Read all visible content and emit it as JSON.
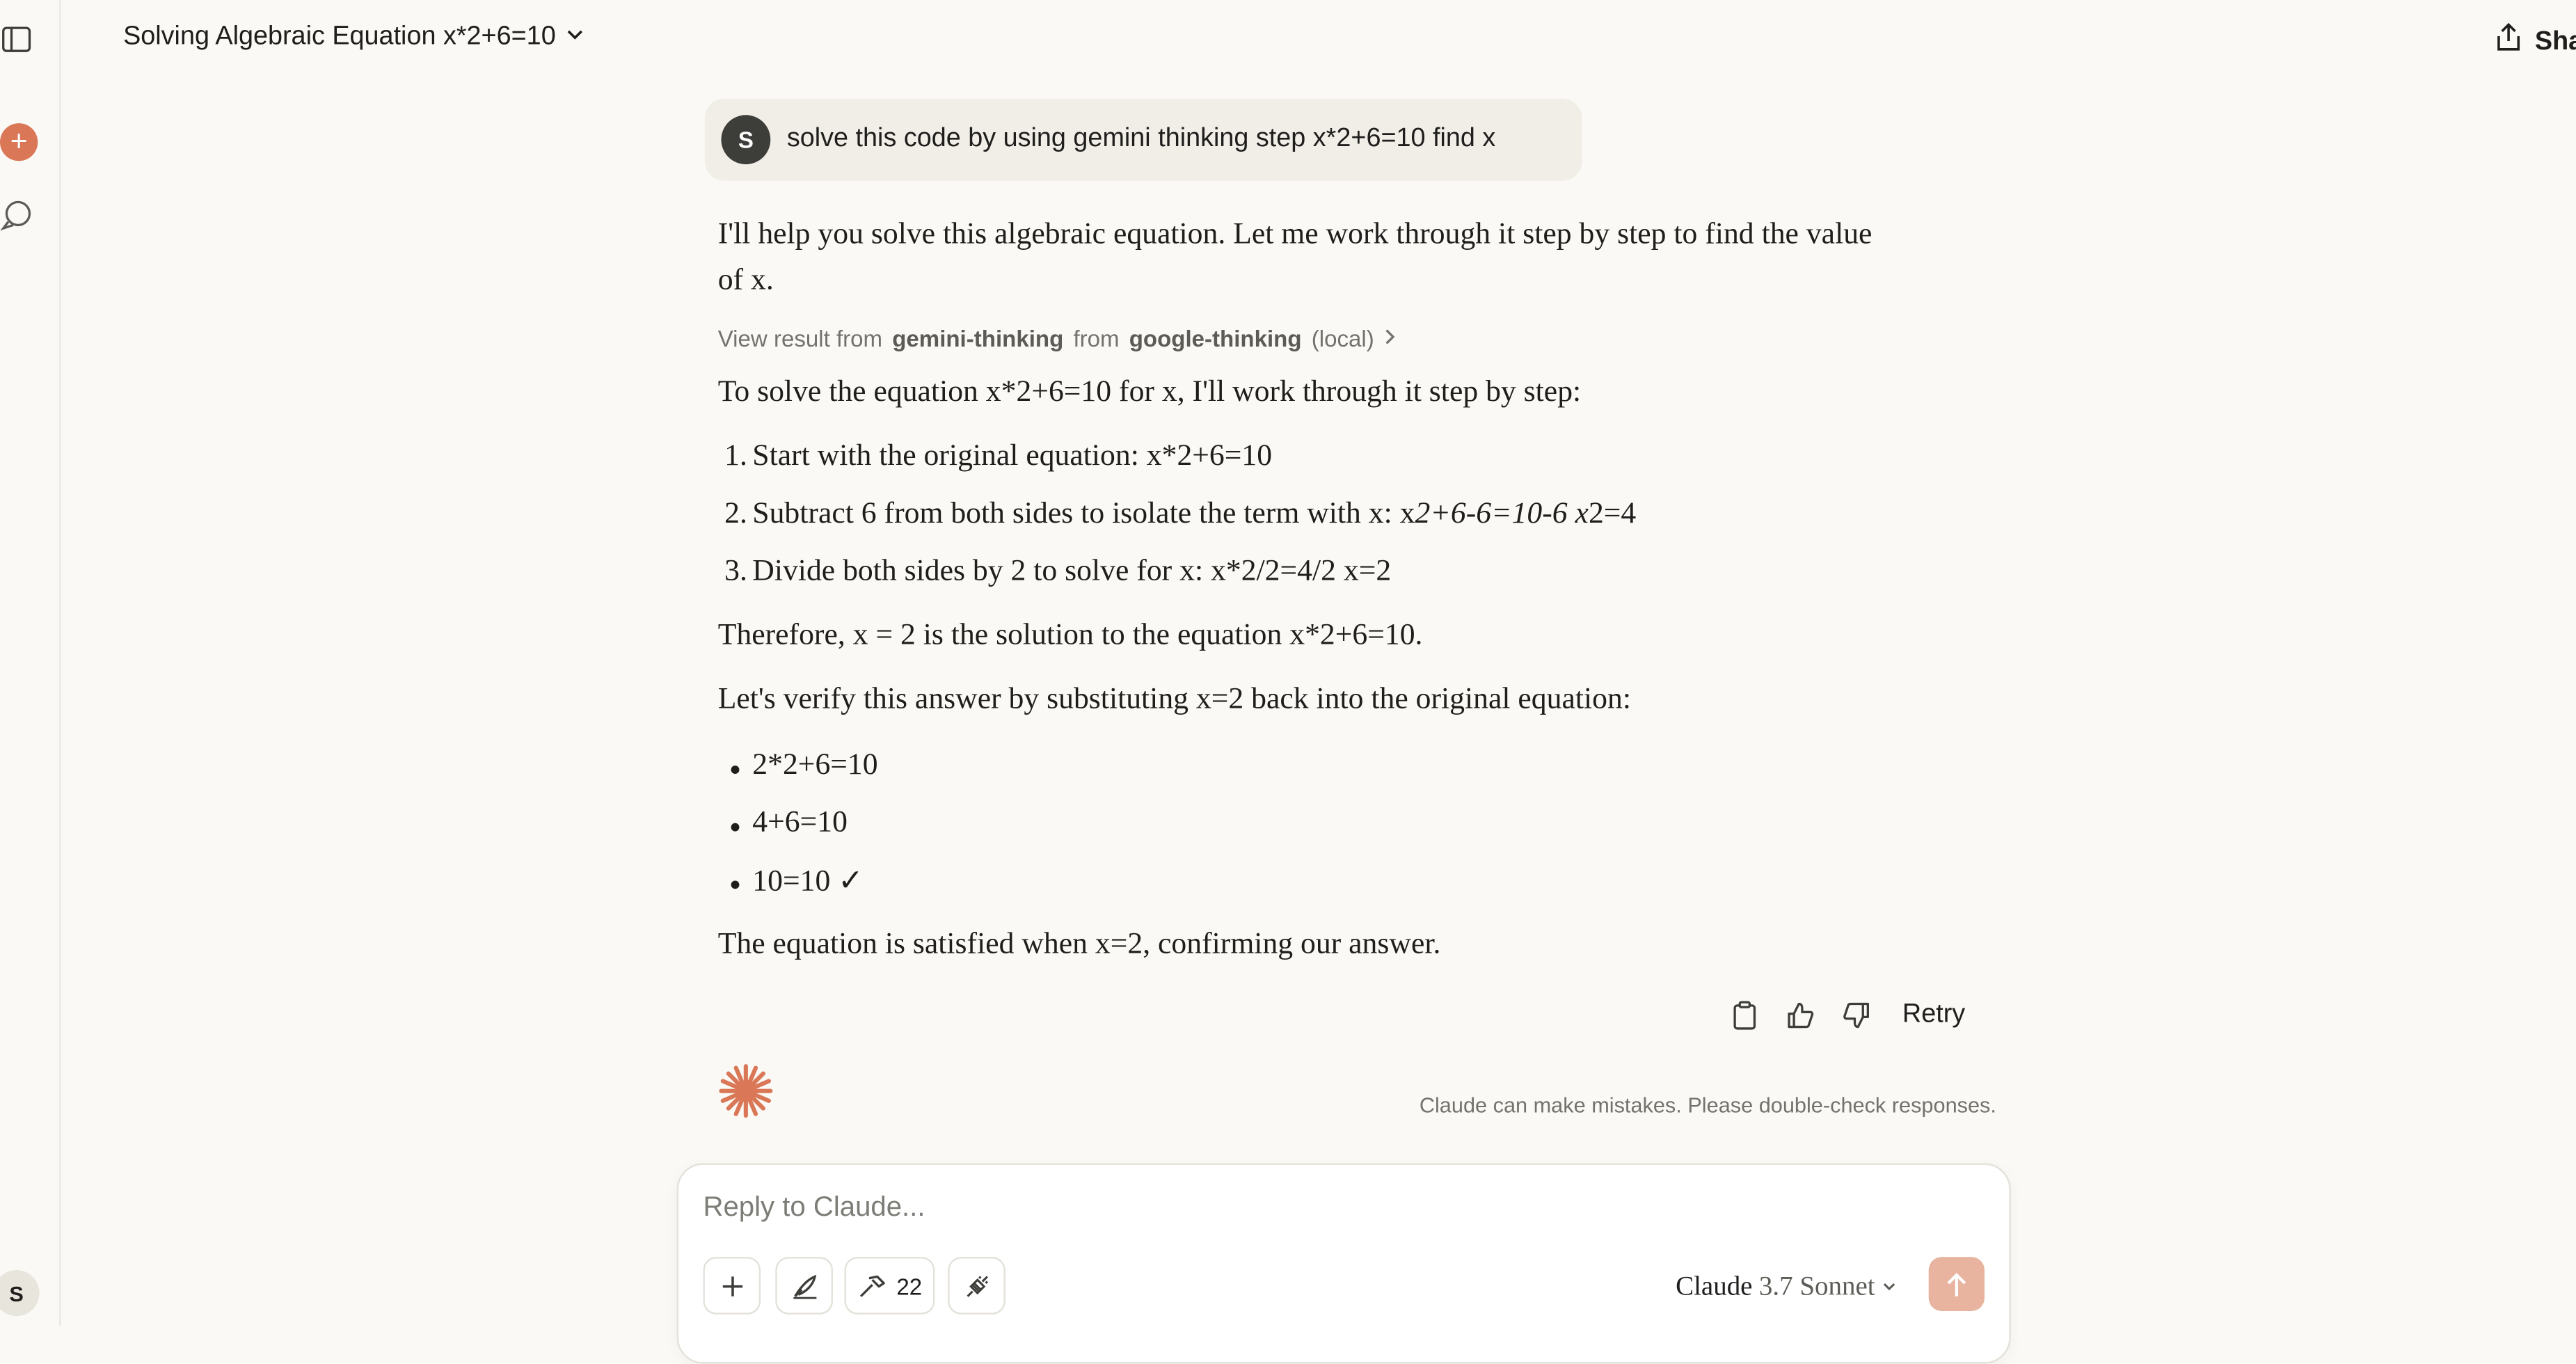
{
  "header": {
    "title": "Solving Algebraic Equation x*2+6=10",
    "share_label": "Sha"
  },
  "sidebar": {
    "user_initial": "S",
    "new_chat_symbol": "+"
  },
  "user_message": {
    "avatar_initial": "S",
    "text": "solve this code by using gemini thinking step x*2+6=10 find x"
  },
  "assistant": {
    "intro_line1": "I'll help you solve this algebraic equation. Let me work through it step by step to find the value",
    "intro_line2": "of x.",
    "tool_result": {
      "prefix": "View result from",
      "tool": "gemini-thinking",
      "mid": "from",
      "server": "google-thinking",
      "suffix": "(local)"
    },
    "solve_intro": "To solve the equation x*2+6=10 for x, I'll work through it step by step:",
    "steps": [
      {
        "num": "1.",
        "text": "Start with the original equation: x*2+6=10"
      },
      {
        "num": "2.",
        "text_a": "Subtract 6 from both sides to isolate the term with x: x",
        "text_b": "2+6-6=10-6 x",
        "text_c": "2=4"
      },
      {
        "num": "3.",
        "text": "Divide both sides by 2 to solve for x: x*2/2=4/2 x=2"
      }
    ],
    "therefore": "Therefore, x = 2 is the solution to the equation x*2+6=10.",
    "verify_intro": "Let's verify this answer by substituting x=2 back into the original equation:",
    "verify_bullets": [
      "2*2+6=10",
      "4+6=10",
      "10=10 ✓"
    ],
    "conclusion": "The equation is satisfied when x=2, confirming our answer."
  },
  "actions": {
    "retry_label": "Retry",
    "icons": [
      "copy-icon",
      "thumbs-up-icon",
      "thumbs-down-icon"
    ]
  },
  "disclaimer": "Claude can make mistakes. Please double-check responses.",
  "composer": {
    "placeholder": "Reply to Claude...",
    "tools_count": "22",
    "model_brand": "Claude",
    "model_version": "3.7 Sonnet"
  },
  "colors": {
    "accent": "#d97757",
    "send_disabled": "#e8b4a0",
    "background": "#faf9f5"
  }
}
